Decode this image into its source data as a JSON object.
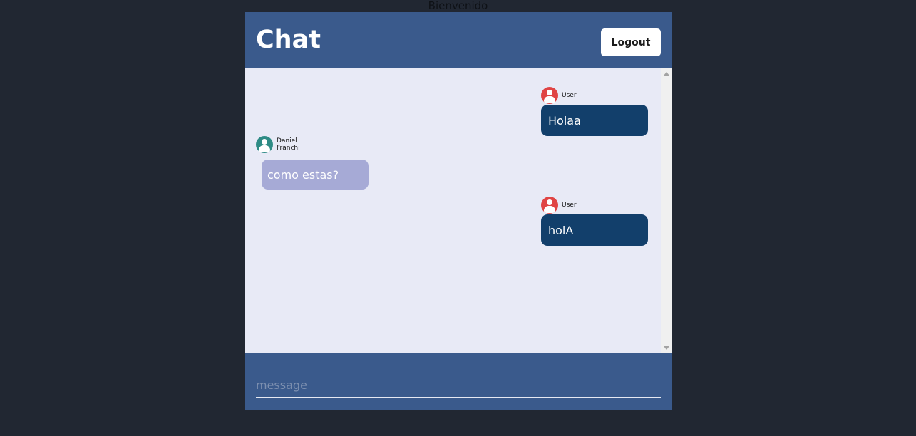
{
  "page": {
    "caption": "Bienvenido"
  },
  "header": {
    "title": "Chat",
    "logout_label": "Logout"
  },
  "messages": [
    {
      "sender": "User",
      "text": "Holaa",
      "own": true,
      "avatar_color": "#e04444"
    },
    {
      "sender": "Daniel Franchi",
      "text": "como estas?",
      "own": false,
      "avatar_color": "#2e8b85"
    },
    {
      "sender": "User",
      "text": "holA",
      "own": true,
      "avatar_color": "#e04444"
    }
  ],
  "composer": {
    "placeholder": "message",
    "value": ""
  },
  "colors": {
    "background": "#212732",
    "header": "#3a5a8c",
    "chat_area": "#e8eaf6",
    "own_bubble": "#123f6b",
    "other_bubble": "#a6aad6"
  }
}
